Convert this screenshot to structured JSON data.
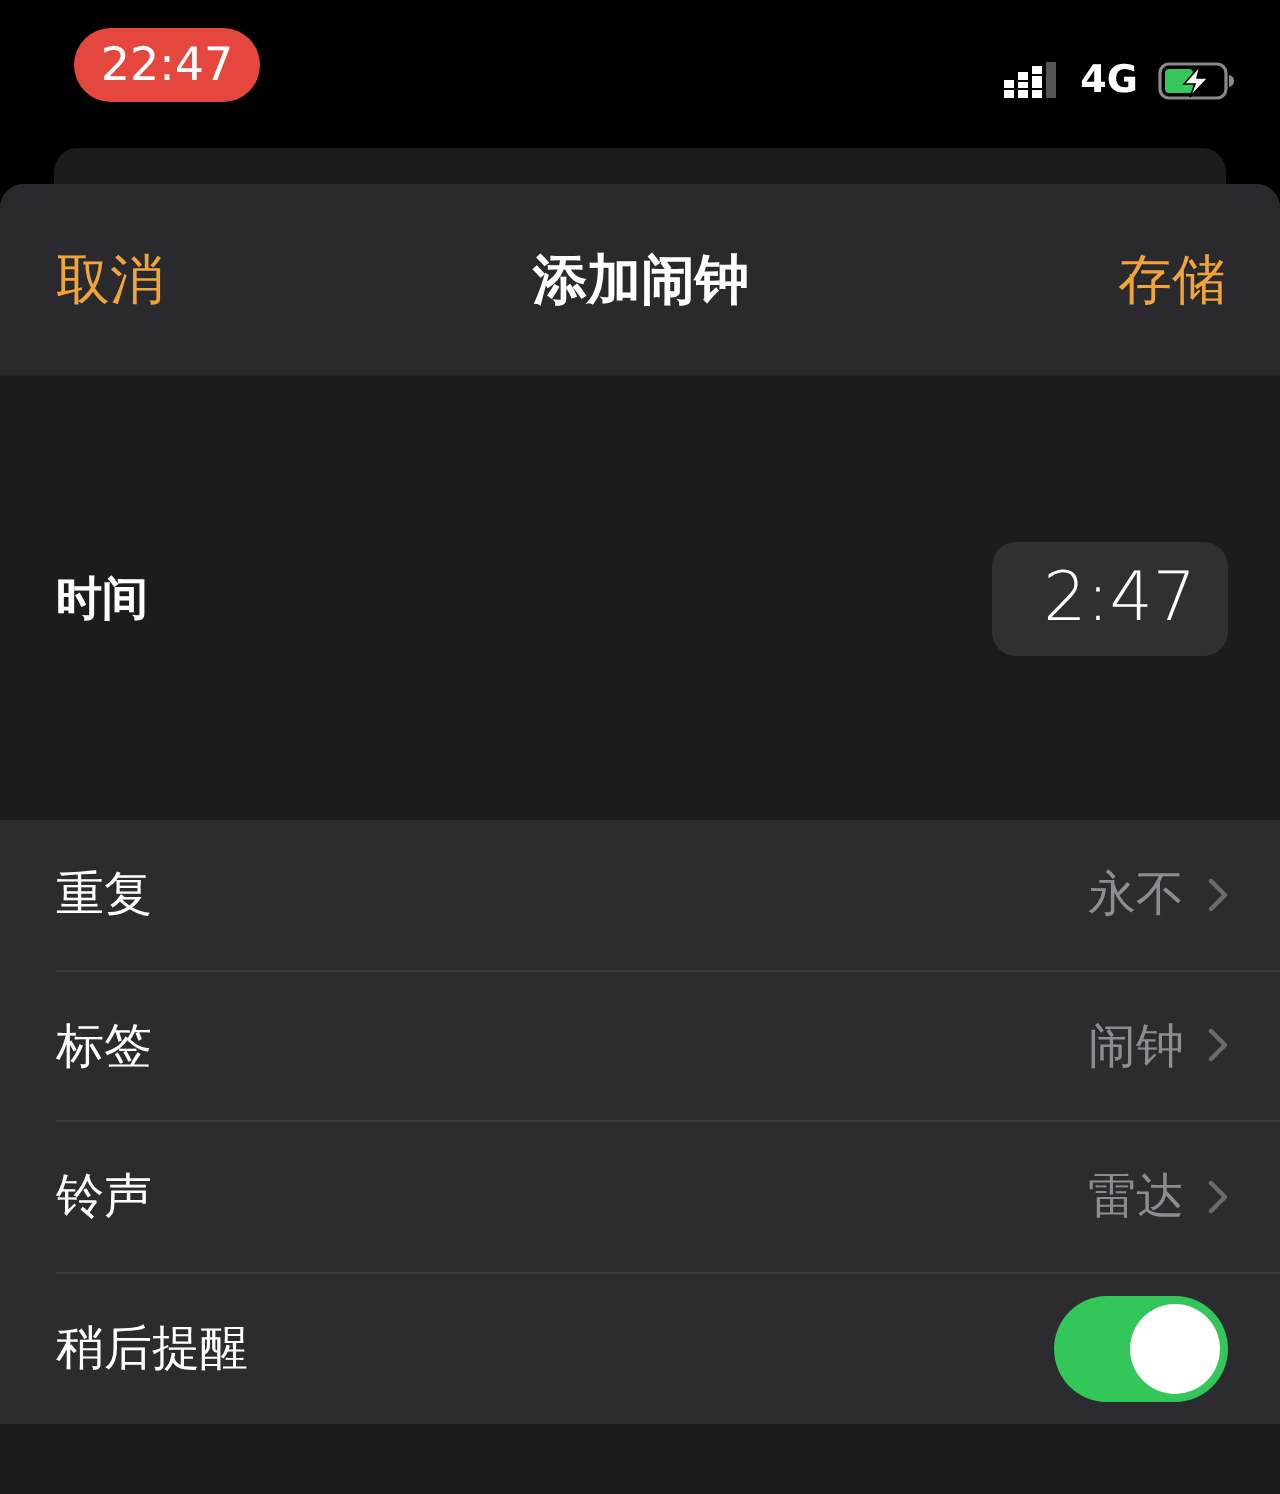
{
  "status_bar": {
    "time": "22:47",
    "network": "4G"
  },
  "header": {
    "cancel": "取消",
    "title": "添加闹钟",
    "save": "存储"
  },
  "time_row": {
    "label": "时间",
    "value": "2:47"
  },
  "options": [
    {
      "kind": "disclosure",
      "label": "重复",
      "value": "永不"
    },
    {
      "kind": "disclosure",
      "label": "标签",
      "value": "闹钟"
    },
    {
      "kind": "disclosure",
      "label": "铃声",
      "value": "雷达"
    },
    {
      "kind": "toggle",
      "label": "稍后提醒",
      "on": true
    }
  ]
}
